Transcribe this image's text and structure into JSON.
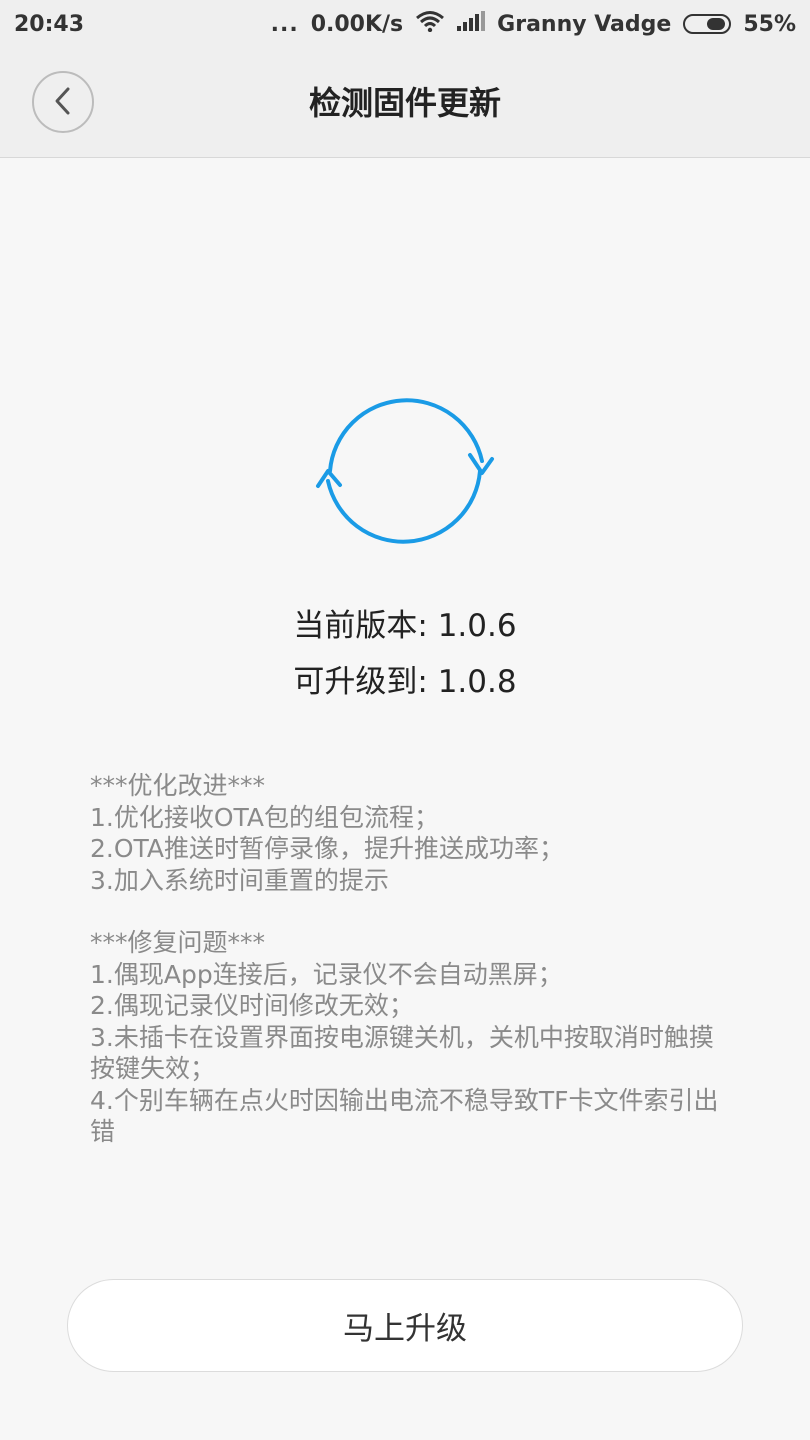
{
  "status_bar": {
    "time": "20:43",
    "dots": "...",
    "net_speed": "0.00K/s",
    "carrier": "Granny Vadge",
    "battery": "55%"
  },
  "header": {
    "title": "检测固件更新"
  },
  "version": {
    "current": "当前版本: 1.0.6",
    "target": "可升级到: 1.0.8"
  },
  "notes": {
    "improvements": [
      "***优化改进***",
      "1.优化接收OTA包的组包流程；",
      "2.OTA推送时暂停录像，提升推送成功率；",
      "3.加入系统时间重置的提示"
    ],
    "fixes": [
      "***修复问题***",
      "1.偶现App连接后，记录仪不会自动黑屏；",
      "2.偶现记录仪时间修改无效；",
      "3.未插卡在设置界面按电源键关机，关机中按取消时触摸按键失效；",
      "4.个别车辆在点火时因输出电流不稳导致TF卡文件索引出错"
    ]
  },
  "actions": {
    "upgrade_label": "马上升级"
  },
  "colors": {
    "accent": "#1a9be6",
    "background": "#f7f7f7",
    "header": "#efefef"
  },
  "icons": {
    "back": "chevron-left-icon",
    "refresh": "refresh-icon",
    "wifi": "wifi-icon",
    "signal": "signal-icon",
    "battery": "battery-icon"
  }
}
